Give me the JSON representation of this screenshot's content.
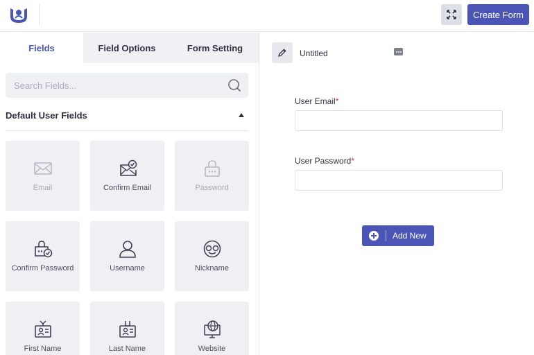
{
  "header": {
    "logo_icon": "user-registration-logo",
    "fullscreen_icon": "fullscreen-icon",
    "create_form_label": "Create Form",
    "accent_color": "#4a55b5"
  },
  "sidebar": {
    "tabs": [
      {
        "label": "Fields",
        "active": true
      },
      {
        "label": "Field Options",
        "active": false
      },
      {
        "label": "Form Setting",
        "active": false
      }
    ],
    "search": {
      "placeholder": "Search Fields...",
      "value": ""
    },
    "section_title": "Default User Fields",
    "fields": [
      {
        "label": "Email",
        "icon": "envelope-icon",
        "disabled": true
      },
      {
        "label": "Confirm Email",
        "icon": "envelope-check-icon",
        "disabled": false
      },
      {
        "label": "Password",
        "icon": "lock-icon",
        "disabled": true
      },
      {
        "label": "Confirm Password",
        "icon": "lock-check-icon",
        "disabled": false
      },
      {
        "label": "Username",
        "icon": "user-icon",
        "disabled": false
      },
      {
        "label": "Nickname",
        "icon": "nickname-face-icon",
        "disabled": false
      },
      {
        "label": "First Name",
        "icon": "id-badge-icon",
        "disabled": false
      },
      {
        "label": "Last Name",
        "icon": "id-badge-icon",
        "disabled": false
      },
      {
        "label": "Website",
        "icon": "globe-monitor-icon",
        "disabled": false
      }
    ]
  },
  "builder": {
    "form_title": "Untitled",
    "fields": [
      {
        "label": "User Email",
        "required_mark": "*",
        "value": ""
      },
      {
        "label": "User Password",
        "required_mark": "*",
        "value": ""
      }
    ],
    "add_new_label": "Add New"
  }
}
